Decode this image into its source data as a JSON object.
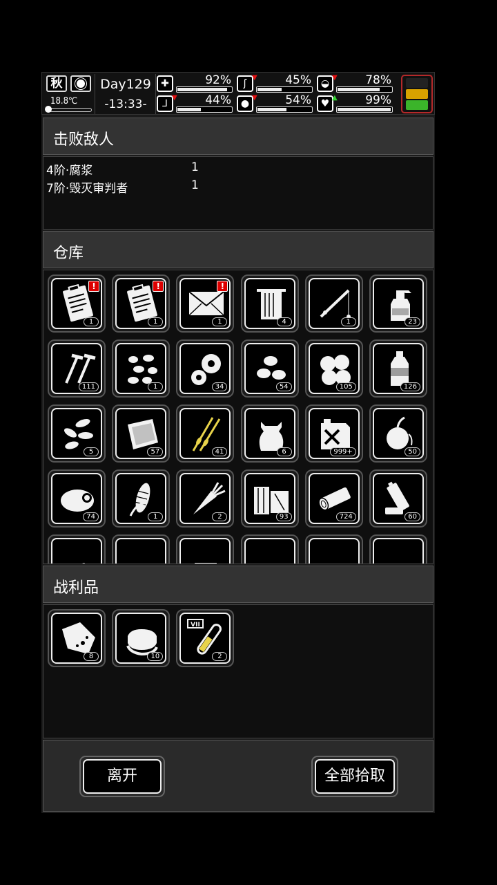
{
  "status": {
    "season": "秋",
    "temperature": "18.8℃",
    "day": "Day129",
    "time": "-13:33-",
    "stats": [
      {
        "icon": "health-kit-icon",
        "glyph": "✚",
        "value": "92%",
        "level": 0.92,
        "trend": "none"
      },
      {
        "icon": "stomach-icon",
        "glyph": "ʃ",
        "value": "45%",
        "level": 0.45,
        "trend": "down"
      },
      {
        "icon": "pill-icon",
        "glyph": "◒",
        "value": "78%",
        "level": 0.78,
        "trend": "down"
      },
      {
        "icon": "boot-icon",
        "glyph": "⅃",
        "value": "44%",
        "level": 0.44,
        "trend": "down"
      },
      {
        "icon": "water-drop-icon",
        "glyph": "●",
        "value": "54%",
        "level": 0.54,
        "trend": "down"
      },
      {
        "icon": "heart-icon",
        "glyph": "♥",
        "value": "99%",
        "level": 0.99,
        "trend": "up"
      }
    ],
    "battery_colors": [
      "#222222",
      "#d8a200",
      "#3bb42a"
    ]
  },
  "defeated": {
    "title": "击败敌人",
    "enemies": [
      {
        "name": "4阶·腐浆",
        "count": "1"
      },
      {
        "name": "7阶·毁灭审判者",
        "count": "1"
      }
    ]
  },
  "warehouse": {
    "title": "仓库",
    "items": [
      {
        "icon": "clipboard-icon",
        "count": "1",
        "alert": "!"
      },
      {
        "icon": "clipboard-icon",
        "count": "1",
        "alert": "!"
      },
      {
        "icon": "envelope-icon",
        "count": "1",
        "alert": "!"
      },
      {
        "icon": "towel-icon",
        "count": "4",
        "alert": ""
      },
      {
        "icon": "fishing-rod-icon",
        "count": "1",
        "alert": ""
      },
      {
        "icon": "spray-bottle-icon",
        "count": "23",
        "alert": ""
      },
      {
        "icon": "screws-icon",
        "count": "111",
        "alert": ""
      },
      {
        "icon": "beans-icon",
        "count": "1",
        "alert": ""
      },
      {
        "icon": "gears-icon",
        "count": "34",
        "alert": ""
      },
      {
        "icon": "seeds-icon",
        "count": "54",
        "alert": ""
      },
      {
        "icon": "nuts-icon",
        "count": "105",
        "alert": ""
      },
      {
        "icon": "bottle-icon",
        "count": "126",
        "alert": ""
      },
      {
        "icon": "sunflower-seeds-icon",
        "count": "5",
        "alert": ""
      },
      {
        "icon": "cloth-icon",
        "count": "57",
        "alert": ""
      },
      {
        "icon": "wheat-icon",
        "count": "41",
        "alert": ""
      },
      {
        "icon": "sack-icon",
        "count": "6",
        "alert": ""
      },
      {
        "icon": "fuel-can-icon",
        "count": "999+",
        "alert": ""
      },
      {
        "icon": "onion-icon",
        "count": "50",
        "alert": ""
      },
      {
        "icon": "meat-icon",
        "count": "74",
        "alert": ""
      },
      {
        "icon": "corn-icon",
        "count": "1",
        "alert": ""
      },
      {
        "icon": "carrot-icon",
        "count": "2",
        "alert": ""
      },
      {
        "icon": "wood-icon",
        "count": "93",
        "alert": ""
      },
      {
        "icon": "log-icon",
        "count": "724",
        "alert": ""
      },
      {
        "icon": "battery-icon",
        "count": "60",
        "alert": ""
      },
      {
        "icon": "paper-icon",
        "count": "",
        "alert": ""
      },
      {
        "icon": "bullets-icon",
        "count": "",
        "alert": ""
      },
      {
        "icon": "jug-icon",
        "count": "",
        "alert": ""
      },
      {
        "icon": "pills-icon",
        "count": "",
        "alert": ""
      },
      {
        "icon": "fan-icon",
        "count": "",
        "alert": ""
      },
      {
        "icon": "bullet-icon",
        "count": "",
        "alert": ""
      }
    ]
  },
  "loot": {
    "title": "战利品",
    "items": [
      {
        "icon": "raw-meat-icon",
        "count": "8"
      },
      {
        "icon": "fabric-icon",
        "count": "10"
      },
      {
        "icon": "test-tube-icon",
        "count": "2",
        "label": "VII"
      }
    ]
  },
  "buttons": {
    "leave": "离开",
    "pick_all": "全部拾取"
  }
}
